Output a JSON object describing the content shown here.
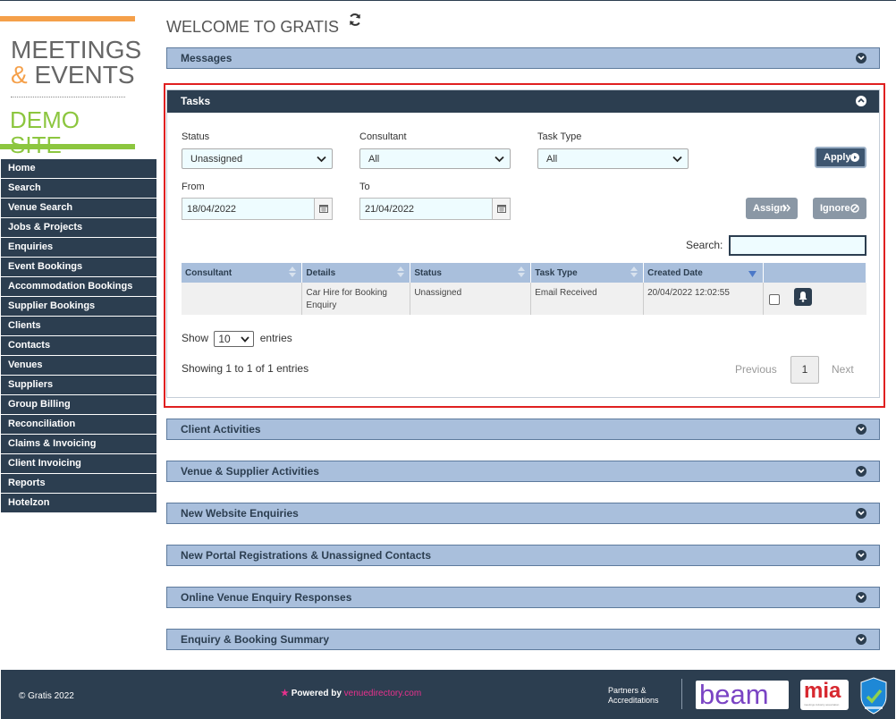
{
  "logo": {
    "line1": "MEETINGS",
    "amp": "&",
    "line2": " EVENTS",
    "line3": "DEMO SITE"
  },
  "sidebar": {
    "items": [
      {
        "label": "Home"
      },
      {
        "label": "Search"
      },
      {
        "label": "Venue Search"
      },
      {
        "label": "Jobs & Projects"
      },
      {
        "label": "Enquiries"
      },
      {
        "label": "Event Bookings"
      },
      {
        "label": "Accommodation Bookings"
      },
      {
        "label": "Supplier Bookings"
      },
      {
        "label": "Clients"
      },
      {
        "label": "Contacts"
      },
      {
        "label": "Venues"
      },
      {
        "label": "Suppliers"
      },
      {
        "label": "Group Billing"
      },
      {
        "label": "Reconciliation"
      },
      {
        "label": "Claims & Invoicing"
      },
      {
        "label": "Client Invoicing"
      },
      {
        "label": "Reports"
      },
      {
        "label": "Hotelzon"
      }
    ]
  },
  "main": {
    "title": "WELCOME TO GRATIS"
  },
  "panels": {
    "messages": "Messages",
    "client_activities": "Client Activities",
    "venue_supplier_activities": "Venue & Supplier Activities",
    "new_website_enquiries": "New Website Enquiries",
    "new_portal_registrations": "New Portal Registrations & Unassigned Contacts",
    "online_venue_enquiry": "Online Venue Enquiry Responses",
    "enquiry_booking_summary": "Enquiry & Booking Summary"
  },
  "tasks": {
    "title": "Tasks",
    "filters": {
      "status_label": "Status",
      "status_value": "Unassigned",
      "consultant_label": "Consultant",
      "consultant_value": "All",
      "task_type_label": "Task Type",
      "task_type_value": "All",
      "from_label": "From",
      "from_value": "18/04/2022",
      "to_label": "To",
      "to_value": "21/04/2022"
    },
    "buttons": {
      "apply": "Apply",
      "assign": "Assign",
      "ignore": "Ignore"
    },
    "search_label": "Search:",
    "search_value": "",
    "columns": [
      "Consultant",
      "Details",
      "Status",
      "Task Type",
      "Created Date"
    ],
    "rows": [
      {
        "consultant": "",
        "details": "Car Hire for Booking Enquiry",
        "status": "Unassigned",
        "task_type": "Email Received",
        "created_date": "20/04/2022 12:02:55"
      }
    ],
    "show_label": "Show",
    "show_value": "10",
    "entries_label": "entries",
    "showing_text": "Showing 1 to 1 of 1 entries",
    "pagination": {
      "previous": "Previous",
      "page": "1",
      "next": "Next"
    }
  },
  "footer": {
    "copyright": "© Gratis 2022",
    "powered_by": "Powered by",
    "powered_brand": "venuedirectory.com",
    "partners_line1": "Partners &",
    "partners_line2": "Accreditations",
    "beam": "beam",
    "mia": "mia",
    "mia_sub": "meetings industry association"
  },
  "colors": {
    "nav_bg": "#2c3e50",
    "panel_bar": "#a9bfdc",
    "accent_orange": "#f5a04a",
    "accent_green": "#8cc63f",
    "highlight_red": "#e02020",
    "brand_pink": "#e8318d"
  }
}
